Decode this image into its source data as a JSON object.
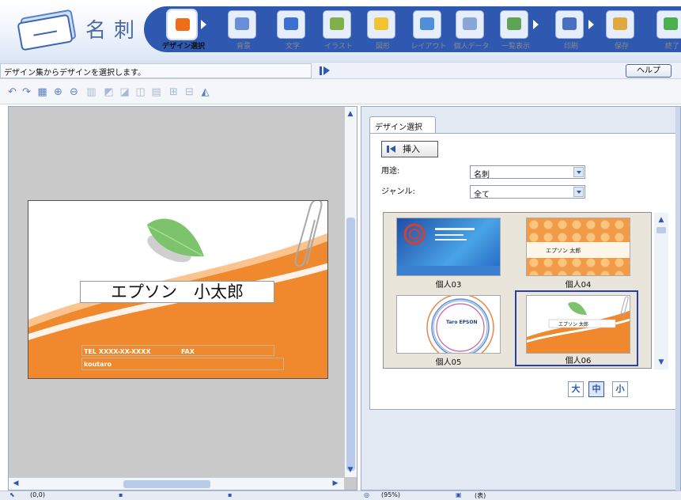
{
  "app": {
    "logo_text": "名刺"
  },
  "steps": [
    {
      "label": "デザイン選択",
      "icon": "design-select-icon",
      "active": true
    },
    {
      "label": "背景",
      "icon": "background-icon",
      "active": false
    },
    {
      "label": "文字",
      "icon": "text-icon",
      "active": false
    },
    {
      "label": "イラスト",
      "icon": "illustration-icon",
      "active": false
    },
    {
      "label": "図形",
      "icon": "shape-icon",
      "active": false
    },
    {
      "label": "レイアウト",
      "icon": "layout-icon",
      "active": false
    },
    {
      "label": "個人データ",
      "icon": "personal-data-icon",
      "active": false
    },
    {
      "label": "一覧表示",
      "icon": "list-view-icon",
      "active": false
    },
    {
      "label": "印刷",
      "icon": "print-icon",
      "active": false
    },
    {
      "label": "保存",
      "icon": "save-icon",
      "active": false
    },
    {
      "label": "終了",
      "icon": "exit-icon",
      "active": false
    }
  ],
  "infobar": {
    "message": "デザイン集からデザインを選択します。",
    "help_label": "ヘルプ"
  },
  "toolbar": {
    "tools": [
      "undo-icon",
      "redo-icon",
      "fit-icon",
      "zoom-in-icon",
      "zoom-out-icon",
      "delete-icon",
      "layer-icon",
      "copy-icon",
      "paste-icon",
      "duplicate-icon",
      "align-icon",
      "distribute-icon",
      "import-icon"
    ]
  },
  "card": {
    "name": "エプソン　小太郎",
    "tel": "TEL XXXX-XX-XXXX",
    "fax": "FAX",
    "mail": "koutaro"
  },
  "panel": {
    "tab_label": "デザイン選択",
    "insert_label": "挿入",
    "usage_label": "用途:",
    "usage_value": "名刺",
    "genre_label": "ジャンル:",
    "genre_value": "全て",
    "thumbnails": [
      {
        "caption": "個人03",
        "selected": false
      },
      {
        "caption": "個人04",
        "selected": false
      },
      {
        "caption": "個人05",
        "selected": false
      },
      {
        "caption": "個人06",
        "selected": true
      }
    ],
    "thumb_texts": {
      "t04_name": "エプソン 太郎",
      "t05_name": "Taro EPSON",
      "t06_name": "エプソン 太郎"
    },
    "size_buttons": [
      {
        "label": "大",
        "active": false
      },
      {
        "label": "中",
        "active": true
      },
      {
        "label": "小",
        "active": false
      }
    ]
  },
  "status": {
    "coord": "(0,0)",
    "zoom": "(95%)",
    "side": "(表)"
  },
  "colors": {
    "brand_blue": "#2f59b0",
    "card_orange": "#f0892e",
    "leaf_green": "#7cc36b",
    "selection_border": "#2a3fa8"
  }
}
